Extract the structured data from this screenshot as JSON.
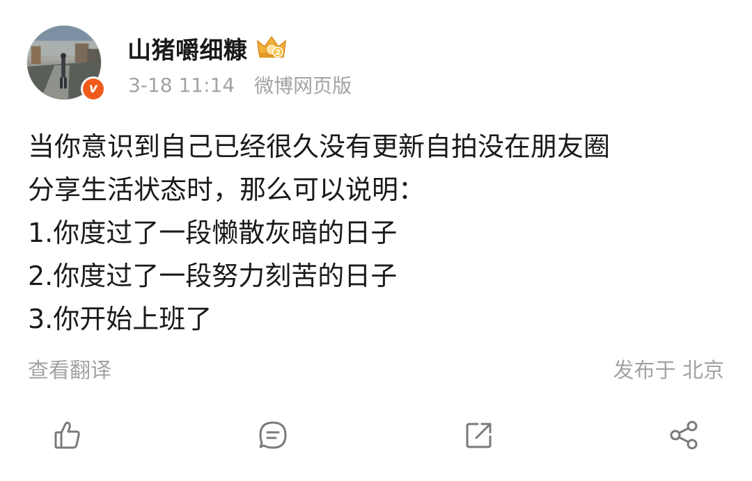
{
  "post": {
    "author": {
      "name": "山猪嚼细糠",
      "avatar_icon": "avatar-photo",
      "verified_badge": "v",
      "level_icon": "crown-level-icon"
    },
    "meta": {
      "time": "3-18 11:14",
      "source": "微博网页版"
    },
    "content": {
      "lines": [
        "当你意识到自己已经很久没有更新自拍没在朋友圈",
        "分享生活状态时，那么可以说明：",
        "1.你度过了一段懒散灰暗的日子",
        "2.你度过了一段努力刻苦的日子",
        "3.你开始上班了"
      ]
    },
    "footer": {
      "translate_label": "查看翻译",
      "location_label": "发布于 北京"
    },
    "actions": {
      "like_icon": "thumbs-up-icon",
      "comment_icon": "comment-icon",
      "repost_icon": "repost-icon",
      "share_icon": "share-icon"
    },
    "colors": {
      "text": "#1a1a1a",
      "muted": "#a3a3a3",
      "badge": "#f05a1a",
      "crown": "#f2b23a",
      "icon": "#7a7a7a"
    }
  }
}
